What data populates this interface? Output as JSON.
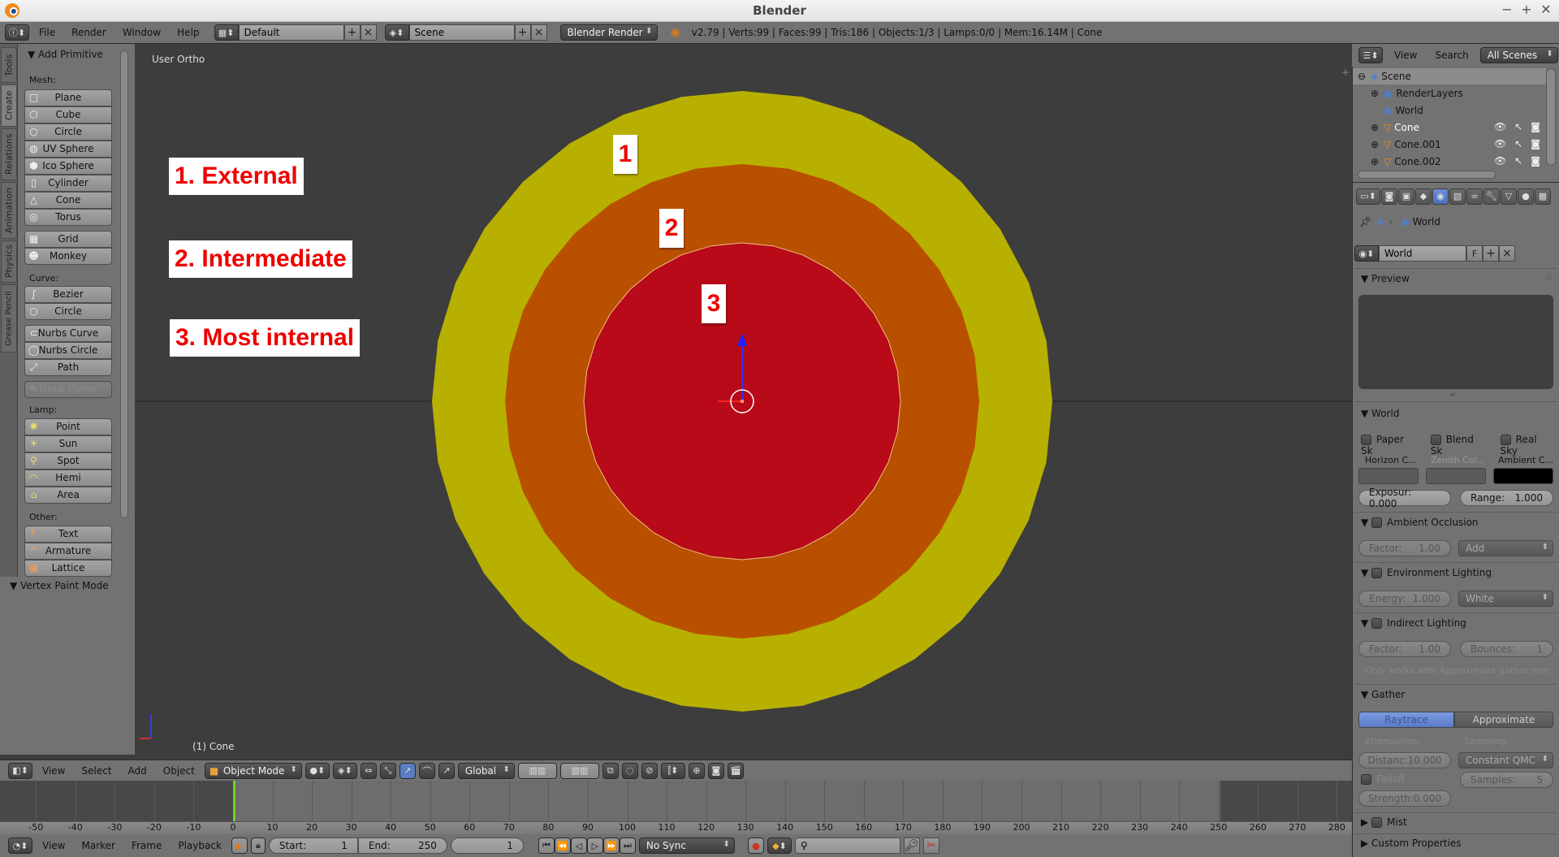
{
  "window": {
    "title": "Blender",
    "controls": [
      "−",
      "+",
      "✕"
    ]
  },
  "topbar": {
    "menus": [
      "File",
      "Render",
      "Window",
      "Help"
    ],
    "layout": "Default",
    "scene": "Scene",
    "engine": "Blender Render",
    "stats": "v2.79 | Verts:99 | Faces:99 | Tris:186 | Objects:1/3 | Lamps:0/0 | Mem:16.14M | Cone"
  },
  "tabs": [
    "Tools",
    "Create",
    "Relations",
    "Animation",
    "Physics",
    "Grease Pencil"
  ],
  "toolbar": {
    "panel_title": "Add Primitive",
    "mesh_label": "Mesh:",
    "mesh": [
      "Plane",
      "Cube",
      "Circle",
      "UV Sphere",
      "Ico Sphere",
      "Cylinder",
      "Cone",
      "Torus"
    ],
    "mesh2": [
      "Grid",
      "Monkey"
    ],
    "curve_label": "Curve:",
    "curve": [
      "Bezier",
      "Circle"
    ],
    "curve2": [
      "Nurbs Curve",
      "Nurbs Circle",
      "Path"
    ],
    "draw_curve": "Draw Curve",
    "lamp_label": "Lamp:",
    "lamp": [
      "Point",
      "Sun",
      "Spot",
      "Hemi",
      "Area"
    ],
    "other_label": "Other:",
    "other": [
      "Text",
      "Armature",
      "Lattice"
    ],
    "vertex_paint": "Vertex Paint Mode"
  },
  "viewport": {
    "view_label": "User Ortho",
    "object_label": "(1) Cone",
    "annotations": [
      "1. External",
      "2. Intermediate",
      "3. Most internal"
    ],
    "ring_labels": [
      "1",
      "2",
      "3"
    ],
    "colors": {
      "outer": "#b8b000",
      "middle": "#b85000",
      "inner": "#b80a18",
      "background": "#3d3d3d"
    }
  },
  "view3d_header": {
    "menus": [
      "View",
      "Select",
      "Add",
      "Object"
    ],
    "mode": "Object Mode",
    "orientation": "Global"
  },
  "timeline": {
    "ticks": [
      "-50",
      "-40",
      "-30",
      "-20",
      "-10",
      "0",
      "10",
      "20",
      "30",
      "40",
      "50",
      "60",
      "70",
      "80",
      "90",
      "100",
      "110",
      "120",
      "130",
      "140",
      "150",
      "160",
      "170",
      "180",
      "190",
      "200",
      "210",
      "220",
      "230",
      "240",
      "250",
      "260",
      "270",
      "280"
    ],
    "current_frame_marker": 0,
    "menus": [
      "View",
      "Marker",
      "Frame",
      "Playback"
    ],
    "start_label": "Start:",
    "start": "1",
    "end_label": "End:",
    "end": "250",
    "current": "1",
    "sync": "No Sync"
  },
  "outliner": {
    "menus": [
      "View",
      "Search"
    ],
    "filter": "All Scenes",
    "items": [
      "Scene",
      "RenderLayers",
      "World",
      "Cone",
      "Cone.001",
      "Cone.002"
    ]
  },
  "properties": {
    "breadcrumb": "World",
    "world_name": "World",
    "fake_user": "F",
    "preview_title": "Preview",
    "world_title": "World",
    "checks": [
      "Paper Sk",
      "Blend Sk",
      "Real Sky"
    ],
    "color_labels": [
      "Horizon C...",
      "Zenith Col...",
      "Ambient C..."
    ],
    "exposure": "Exposur: 0.000",
    "range_label": "Range:",
    "range": "1.000",
    "ao_title": "Ambient Occlusion",
    "ao_factor_label": "Factor:",
    "ao_factor": "1.00",
    "ao_blend": "Add",
    "env_title": "Environment Lighting",
    "env_energy_label": "Energy:",
    "env_energy": "1.000",
    "env_color": "White",
    "indirect_title": "Indirect Lighting",
    "ind_factor_label": "Factor:",
    "ind_factor": "1.00",
    "bounces_label": "Bounces:",
    "bounces": "1",
    "ind_note": "Only works with Approximate gather met",
    "gather_title": "Gather",
    "gather_modes": [
      "Raytrace",
      "Approximate"
    ],
    "attenuation_label": "Attenuation:",
    "sampling_label": "Sampling:",
    "distance": "Distanc:10.000",
    "sampling": "Constant QMC",
    "falloff": "Falloff",
    "samples_label": "Samples:",
    "samples": "5",
    "strength": "Strength:0.000",
    "mist_title": "Mist",
    "custom_title": "Custom Properties"
  }
}
